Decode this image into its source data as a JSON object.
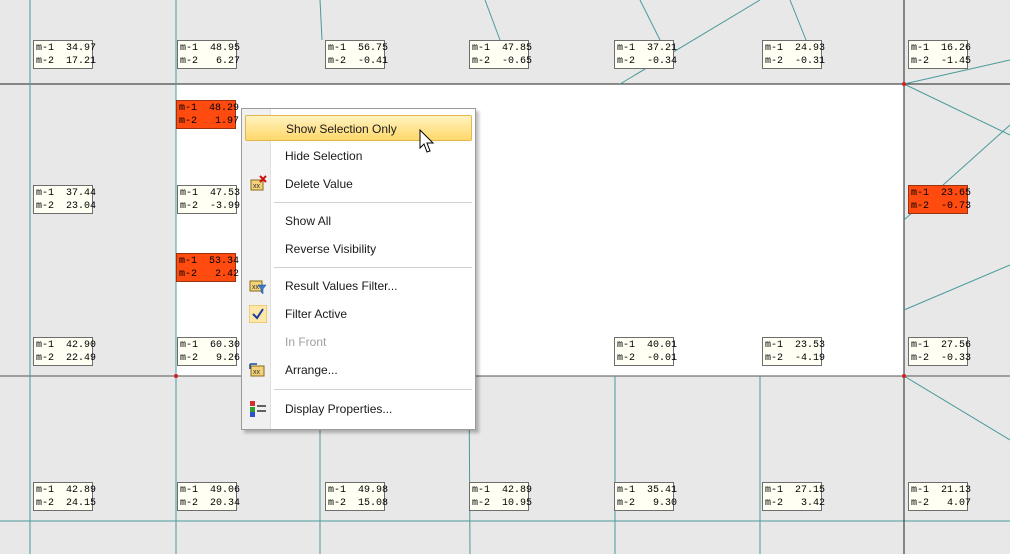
{
  "labels": [
    {
      "m1": "m-1  34.97",
      "m2": "m-2  17.21",
      "selected": false
    },
    {
      "m1": "m-1  48.95",
      "m2": "m-2   6.27",
      "selected": false
    },
    {
      "m1": "m-1  56.75",
      "m2": "m-2  -0.41",
      "selected": false
    },
    {
      "m1": "m-1  47.85",
      "m2": "m-2  -0.65",
      "selected": false
    },
    {
      "m1": "m-1  37.21",
      "m2": "m-2  -0.34",
      "selected": false
    },
    {
      "m1": "m-1  24.93",
      "m2": "m-2  -0.31",
      "selected": false
    },
    {
      "m1": "m-1  16.26",
      "m2": "m-2  -1.45",
      "selected": false
    },
    {
      "m1": "m-1  48.29",
      "m2": "m-2   1.97",
      "selected": true
    },
    {
      "m1": "m-1  37.44",
      "m2": "m-2  23.04",
      "selected": false
    },
    {
      "m1": "m-1  47.53",
      "m2": "m-2  -3.99",
      "selected": false
    },
    {
      "m1": "m-1  23.65",
      "m2": "m-2  -0.73",
      "selected": true
    },
    {
      "m1": "m-1  53.34",
      "m2": "m-2   2.42",
      "selected": true
    },
    {
      "m1": "m-1  42.90",
      "m2": "m-2  22.49",
      "selected": false
    },
    {
      "m1": "m-1  60.30",
      "m2": "m-2   9.26",
      "selected": false
    },
    {
      "m1": "m-1  40.01",
      "m2": "m-2  -0.01",
      "selected": false
    },
    {
      "m1": "m-1  23.53",
      "m2": "m-2  -4.19",
      "selected": false
    },
    {
      "m1": "m-1  27.56",
      "m2": "m-2  -0.33",
      "selected": false
    },
    {
      "m1": "m-1  42.89",
      "m2": "m-2  24.15",
      "selected": false
    },
    {
      "m1": "m-1  49.06",
      "m2": "m-2  20.34",
      "selected": false
    },
    {
      "m1": "m-1  49.98",
      "m2": "m-2  15.08",
      "selected": false
    },
    {
      "m1": "m-1  42.89",
      "m2": "m-2  10.95",
      "selected": false
    },
    {
      "m1": "m-1  35.41",
      "m2": "m-2   9.30",
      "selected": false
    },
    {
      "m1": "m-1  27.15",
      "m2": "m-2   3.42",
      "selected": false
    },
    {
      "m1": "m-1  21.13",
      "m2": "m-2   4.07",
      "selected": false
    }
  ],
  "context_menu": {
    "items": [
      {
        "label": "Show Selection Only",
        "icon": "none",
        "state": "highlighted"
      },
      {
        "label": "Hide Selection",
        "icon": "none",
        "state": "normal"
      },
      {
        "label": "Delete Value",
        "icon": "delete-value-icon",
        "state": "normal"
      },
      {
        "label": "Show All",
        "icon": "none",
        "state": "normal"
      },
      {
        "label": "Reverse Visibility",
        "icon": "none",
        "state": "normal"
      },
      {
        "label": "Result Values Filter...",
        "icon": "filter-icon",
        "state": "normal"
      },
      {
        "label": "Filter Active",
        "icon": "checkmark-icon",
        "state": "checked"
      },
      {
        "label": "In Front",
        "icon": "none",
        "state": "disabled"
      },
      {
        "label": "Arrange...",
        "icon": "arrange-icon",
        "state": "normal"
      },
      {
        "label": "Display Properties...",
        "icon": "display-properties-icon",
        "state": "normal"
      }
    ]
  },
  "colors": {
    "background": "#e8e8e8",
    "selected_region": "#ffffff",
    "mesh_line": "#4a9a9a",
    "label_bg": "#fffff4",
    "label_selected_bg": "#ff4a10",
    "menu_highlight": "#ffd86a"
  }
}
